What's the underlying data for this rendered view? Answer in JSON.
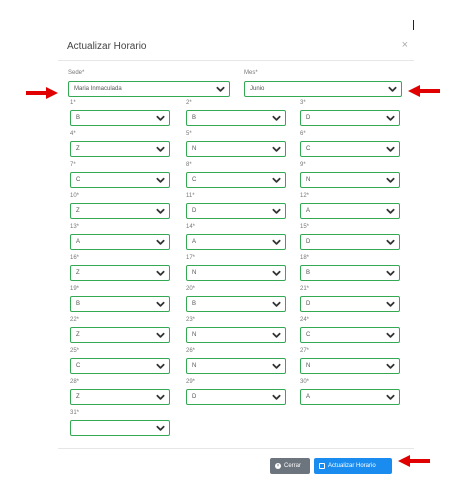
{
  "modal": {
    "title": "Actualizar Horario",
    "close_glyph": "×"
  },
  "fields": {
    "sede_label": "Sede*",
    "sede_value": "Maria Inmaculada",
    "mes_label": "Mes*",
    "mes_value": "Junio"
  },
  "days": [
    {
      "label": "1*",
      "value": "B"
    },
    {
      "label": "2*",
      "value": "B"
    },
    {
      "label": "3*",
      "value": "D"
    },
    {
      "label": "4*",
      "value": "Z"
    },
    {
      "label": "5*",
      "value": "N"
    },
    {
      "label": "6*",
      "value": "C"
    },
    {
      "label": "7*",
      "value": "C"
    },
    {
      "label": "8*",
      "value": "C"
    },
    {
      "label": "9*",
      "value": "N"
    },
    {
      "label": "10*",
      "value": "Z"
    },
    {
      "label": "11*",
      "value": "D"
    },
    {
      "label": "12*",
      "value": "A"
    },
    {
      "label": "13*",
      "value": "A"
    },
    {
      "label": "14*",
      "value": "A"
    },
    {
      "label": "15*",
      "value": "D"
    },
    {
      "label": "16*",
      "value": "Z"
    },
    {
      "label": "17*",
      "value": "N"
    },
    {
      "label": "18*",
      "value": "B"
    },
    {
      "label": "19*",
      "value": "B"
    },
    {
      "label": "20*",
      "value": "B"
    },
    {
      "label": "21*",
      "value": "D"
    },
    {
      "label": "22*",
      "value": "Z"
    },
    {
      "label": "23*",
      "value": "N"
    },
    {
      "label": "24*",
      "value": "C"
    },
    {
      "label": "25*",
      "value": "C"
    },
    {
      "label": "26*",
      "value": "N"
    },
    {
      "label": "27*",
      "value": "N"
    },
    {
      "label": "28*",
      "value": "Z"
    },
    {
      "label": "29*",
      "value": "D"
    },
    {
      "label": "30*",
      "value": "A"
    },
    {
      "label": "31*",
      "value": ""
    }
  ],
  "buttons": {
    "close_label": "Cerrar",
    "save_label": "Actualizar Horario",
    "close_icon": "times-circle-icon",
    "save_icon": "save-icon"
  },
  "colors": {
    "field_border": "#34a853",
    "primary": "#1a8cf0",
    "secondary": "#6c757d",
    "arrow": "#e00000"
  }
}
